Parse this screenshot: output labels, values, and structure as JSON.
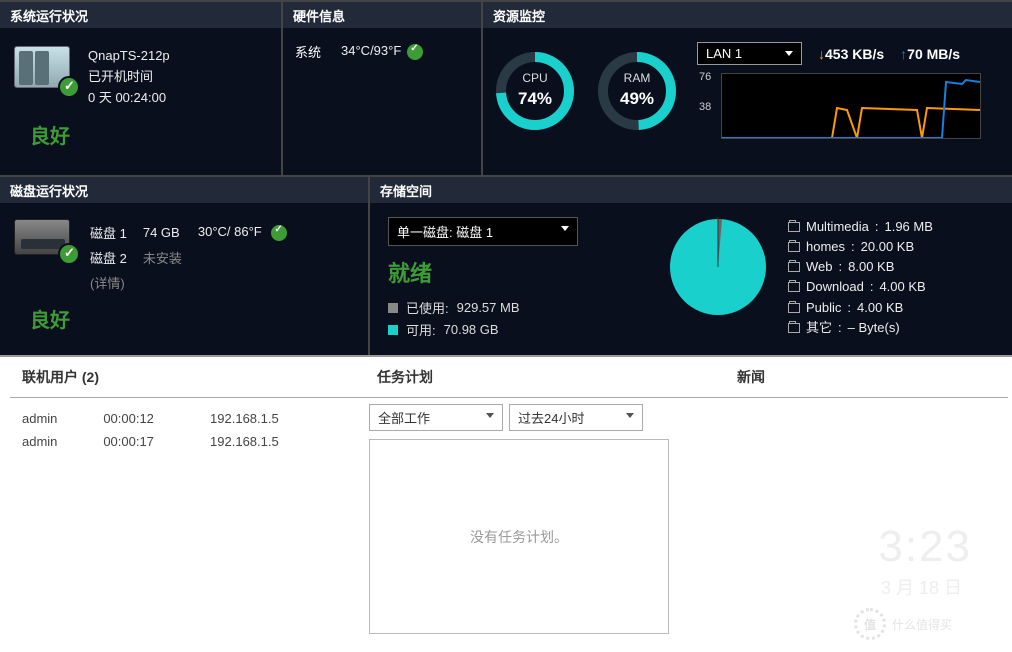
{
  "system_status": {
    "title": "系统运行状况",
    "model": "QnapTS-212p",
    "uptime_label": "已开机时间",
    "uptime_value": "0 天 00:24:00",
    "status_text": "良好"
  },
  "hardware": {
    "title": "硬件信息",
    "row_label": "系统",
    "temp": "34°C/93°F"
  },
  "resource": {
    "title": "资源监控",
    "cpu_label": "CPU",
    "cpu_pct": "74%",
    "cpu_val": 74,
    "ram_label": "RAM",
    "ram_pct": "49%",
    "ram_val": 49,
    "lan_selected": "LAN 1",
    "down_speed": "453 KB/s",
    "up_speed": "70 MB/s",
    "tick_hi": "76",
    "tick_lo": "38"
  },
  "disk_status": {
    "title": "磁盘运行状况",
    "disks": [
      {
        "name": "磁盘 1",
        "size": "74 GB",
        "temp": "30°C/ 86°F"
      },
      {
        "name": "磁盘 2",
        "size": "未安装",
        "temp": ""
      }
    ],
    "details": "(详情)",
    "status_text": "良好"
  },
  "storage": {
    "title": "存储空间",
    "selector": "单一磁盘: 磁盘 1",
    "ready": "就绪",
    "used_label": "已使用:",
    "used_val": "929.57 MB",
    "avail_label": "可用:",
    "avail_val": "70.98 GB",
    "folders": [
      {
        "name": "Multimedia",
        "size": "1.96 MB"
      },
      {
        "name": "homes",
        "size": "20.00 KB"
      },
      {
        "name": "Web",
        "size": "8.00 KB"
      },
      {
        "name": "Download",
        "size": "4.00 KB"
      },
      {
        "name": "Public",
        "size": "4.00 KB"
      },
      {
        "name": "其它",
        "size": "– Byte(s)"
      }
    ]
  },
  "online_users": {
    "title": "联机用户 (2)",
    "rows": [
      {
        "user": "admin",
        "time": "00:00:12",
        "ip": "192.168.1.5"
      },
      {
        "user": "admin",
        "time": "00:00:17",
        "ip": "192.168.1.5"
      }
    ]
  },
  "tasks": {
    "title": "任务计划",
    "filter1": "全部工作",
    "filter2": "过去24小时",
    "empty": "没有任务计划。"
  },
  "news": {
    "title": "新闻"
  },
  "watermark": {
    "time": "3:23",
    "date": "3 月 18 日",
    "brand": "什么值得买"
  }
}
